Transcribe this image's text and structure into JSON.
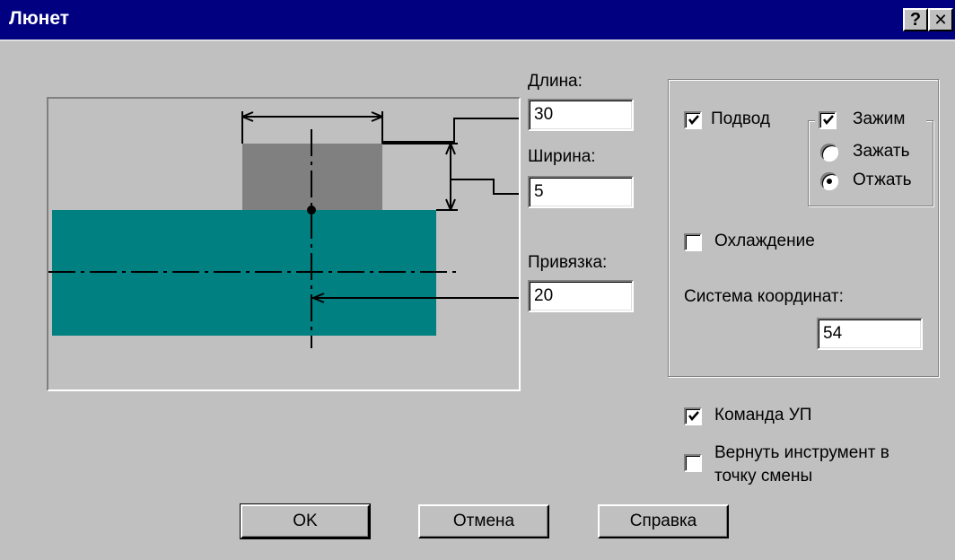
{
  "window": {
    "title": "Люнет",
    "help_button": "?",
    "close_button": "✕"
  },
  "colors": {
    "titlebar": "#000080",
    "face": "#c0c0c0",
    "workpiece": "#008080",
    "jaw": "#808080"
  },
  "fields": {
    "length": {
      "label": "Длина:",
      "value": "30"
    },
    "width": {
      "label": "Ширина:",
      "value": "5"
    },
    "offset": {
      "label": "Привязка:",
      "value": "20"
    }
  },
  "options": {
    "approach": {
      "label": "Подвод",
      "checked": true
    },
    "clamp_group": {
      "label": "Зажим",
      "checked": true,
      "radios": [
        {
          "label": "Зажать",
          "selected": false
        },
        {
          "label": "Отжать",
          "selected": true
        }
      ]
    },
    "cooling": {
      "label": "Охлаждение",
      "checked": false
    },
    "coord_system": {
      "label": "Система координат:",
      "value": "54"
    }
  },
  "bottom_checks": {
    "nc_command": {
      "label": "Команда УП",
      "checked": true
    },
    "return_tool": {
      "label_line1": "Вернуть инструмент в",
      "label_line2": "точку смены",
      "checked": false
    }
  },
  "buttons": {
    "ok": "OK",
    "cancel": "Отмена",
    "help": "Справка"
  }
}
